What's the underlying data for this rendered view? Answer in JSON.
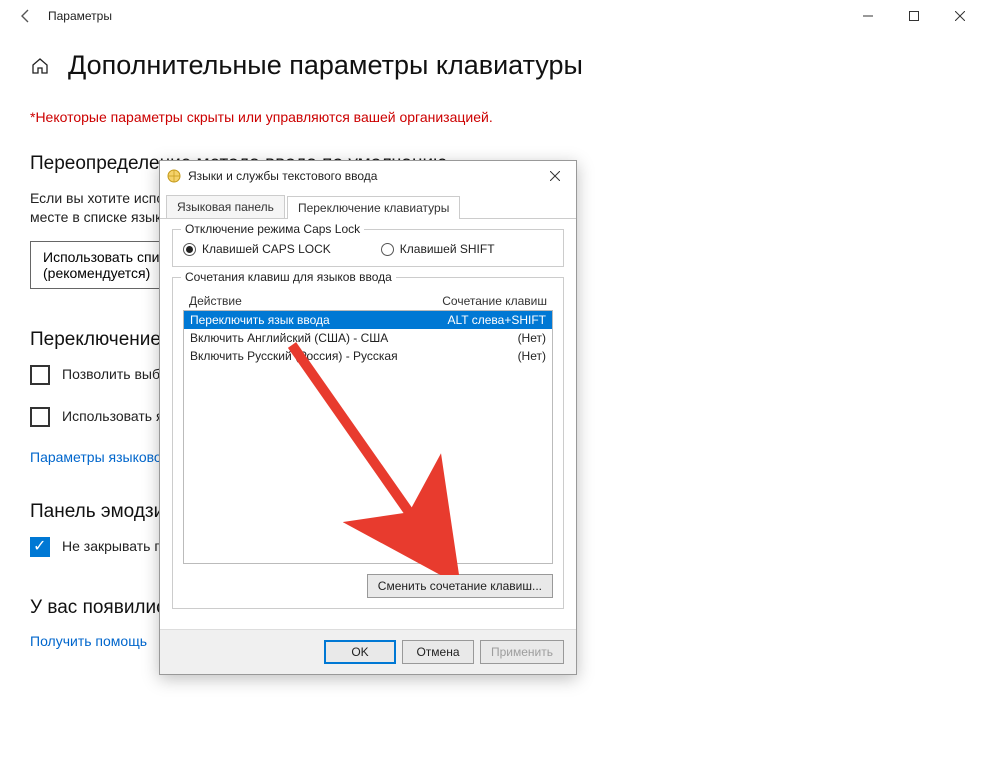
{
  "titlebar": {
    "title": "Параметры"
  },
  "page": {
    "heading": "Дополнительные параметры клавиатуры",
    "policy_note": "*Некоторые параметры скрыты или управляются вашей организацией.",
    "section_override": "Переопределение метода ввода по умолчанию",
    "override_text": "Если вы хотите использовать метод ввода, отличный от указанного на первом месте в списке языков, выберите его здесь.",
    "dropdown_label": "Использовать список языков (рекомендуется)",
    "section_switch": "Переключение методов ввода",
    "chk1_label": "Позволить выбирать метод ввода для каждого приложения",
    "chk2_label": "Использовать языковую панель на рабочем столе, если она доступна",
    "link_lang_params": "Параметры языковой панели",
    "section_emoji": "Панель эмодзи",
    "chk3_label": "Не закрывать панель автоматически после ввода эмодзи",
    "section_questions": "У вас появились вопросы?",
    "link_help": "Получить помощь"
  },
  "dialog": {
    "title": "Языки и службы текстового ввода",
    "tabs": {
      "panel": "Языковая панель",
      "switch": "Переключение клавиатуры"
    },
    "group_caps": {
      "legend": "Отключение режима Caps Lock",
      "opt1": "Клавишей CAPS LOCK",
      "opt2": "Клавишей SHIFT"
    },
    "group_hotkeys": {
      "legend": "Сочетания клавиш для языков ввода",
      "col_action": "Действие",
      "col_combo": "Сочетание клавиш",
      "rows": [
        {
          "action": "Переключить язык ввода",
          "combo": "ALT слева+SHIFT"
        },
        {
          "action": "Включить Английский (США) - США",
          "combo": "(Нет)"
        },
        {
          "action": "Включить Русский (Россия) - Русская",
          "combo": "(Нет)"
        }
      ],
      "change_btn": "Сменить сочетание клавиш..."
    },
    "buttons": {
      "ok": "OK",
      "cancel": "Отмена",
      "apply": "Применить"
    }
  }
}
